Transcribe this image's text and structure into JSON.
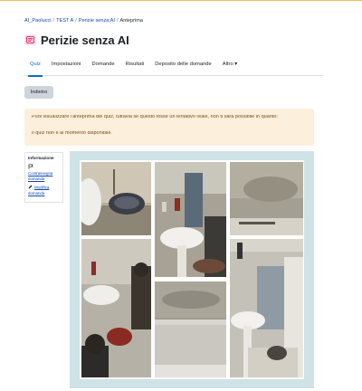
{
  "breadcrumb": {
    "items": [
      "AI_Paolucci",
      "TEST A",
      "Perizie senza AI",
      "Anteprima"
    ]
  },
  "header": {
    "title": "Perizie senza AI",
    "icon": "quiz-icon",
    "icon_color": "#e2336b"
  },
  "tabs": [
    {
      "label": "Quiz",
      "active": true
    },
    {
      "label": "Impostazioni"
    },
    {
      "label": "Domande"
    },
    {
      "label": "Risultati"
    },
    {
      "label": "Deposito delle domande"
    },
    {
      "label": "Altro ▾"
    }
  ],
  "actions": {
    "back_label": "Indietro"
  },
  "alert": {
    "line1": "Puoi visualizzare l'anteprima del quiz, tuttavia se questo fosse un tentativo reale, non ti sarà possibile in quanto:",
    "line2": "Il quiz non è al momento disponibile."
  },
  "info": {
    "title": "Informazione",
    "flag_label": "Contrassegna domanda",
    "edit_label": "Modifica domanda"
  },
  "colors": {
    "accent": "#0f6cbf",
    "alert_bg": "#fcefdc",
    "alert_text": "#7d4d10",
    "frame_bg": "#cfe2e6"
  }
}
